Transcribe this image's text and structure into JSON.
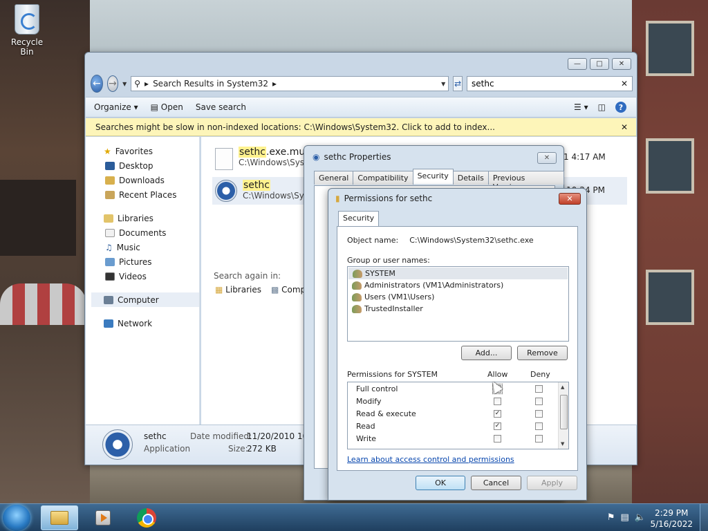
{
  "desktop": {
    "recycle_bin_label": "Recycle Bin"
  },
  "explorer": {
    "address_path": "Search Results in System32",
    "search_value": "sethc",
    "toolbar": {
      "organize": "Organize",
      "open": "Open",
      "save_search": "Save search"
    },
    "info_bar": "Searches might be slow in non-indexed locations: C:\\Windows\\System32. Click to add to index...",
    "nav": {
      "favorites": "Favorites",
      "desktop": "Desktop",
      "downloads": "Downloads",
      "recent_places": "Recent Places",
      "libraries": "Libraries",
      "documents": "Documents",
      "music": "Music",
      "pictures": "Pictures",
      "videos": "Videos",
      "computer": "Computer",
      "network": "Network"
    },
    "results": [
      {
        "name": "sethc",
        "name_rest": ".exe.mui",
        "path": "C:\\Windows\\Syst",
        "time": "1 4:17 AM"
      },
      {
        "name": "sethc",
        "name_rest": "",
        "path": "C:\\Windows\\Syst",
        "time": "10:24 PM"
      }
    ],
    "search_again_label": "Search again in:",
    "search_again_links": {
      "libraries": "Libraries",
      "computer": "Comp"
    },
    "details": {
      "name": "sethc",
      "type": "Application",
      "date_modified_label": "Date modified:",
      "date_modified": "11/20/2010 10:2",
      "size_label": "Size:",
      "size": "272 KB"
    }
  },
  "properties": {
    "title": "sethc Properties",
    "tabs": [
      "General",
      "Compatibility",
      "Security",
      "Details",
      "Previous Versions"
    ],
    "active_tab": "Security"
  },
  "permissions": {
    "title": "Permissions for sethc",
    "tab": "Security",
    "object_name_label": "Object name:",
    "object_name": "C:\\Windows\\System32\\sethc.exe",
    "group_label": "Group or user names:",
    "users": [
      "SYSTEM",
      "Administrators (VM1\\Administrators)",
      "Users (VM1\\Users)",
      "TrustedInstaller"
    ],
    "add_button": "Add...",
    "remove_button": "Remove",
    "perm_for_label": "Permissions for SYSTEM",
    "allow_label": "Allow",
    "deny_label": "Deny",
    "rows": [
      {
        "name": "Full control",
        "allow": false,
        "deny": false
      },
      {
        "name": "Modify",
        "allow": false,
        "deny": false
      },
      {
        "name": "Read & execute",
        "allow": true,
        "deny": false
      },
      {
        "name": "Read",
        "allow": true,
        "deny": false
      },
      {
        "name": "Write",
        "allow": false,
        "deny": false
      }
    ],
    "learn_link": "Learn about access control and permissions",
    "ok": "OK",
    "cancel": "Cancel",
    "apply": "Apply"
  },
  "taskbar": {
    "time": "2:29 PM",
    "date": "5/16/2022"
  }
}
